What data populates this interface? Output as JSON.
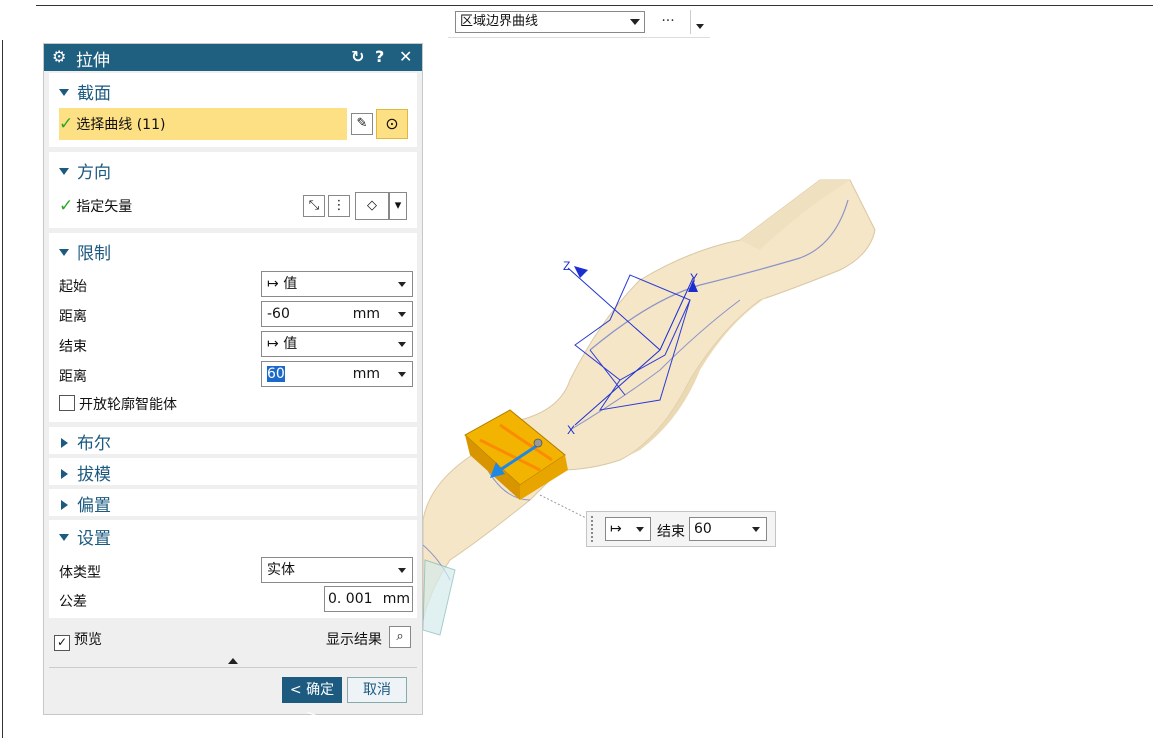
{
  "toolbar": {
    "filter_value": "区域边界曲线",
    "more": "···"
  },
  "dialog": {
    "title": "拉伸",
    "sections": {
      "section": {
        "title": "截面",
        "select_curve": "选择曲线 (11)"
      },
      "direction": {
        "title": "方向",
        "specify_vector": "指定矢量"
      },
      "limits": {
        "title": "限制",
        "start_label": "起始",
        "start_value": "值",
        "start_distance_label": "距离",
        "start_distance_value": "-60",
        "start_distance_unit": "mm",
        "end_label": "结束",
        "end_value": "值",
        "end_distance_label": "距离",
        "end_distance_value": "60",
        "end_distance_unit": "mm",
        "open_profile_label": "开放轮廓智能体"
      },
      "boolean": {
        "title": "布尔"
      },
      "draft": {
        "title": "拔模"
      },
      "offset": {
        "title": "偏置"
      },
      "settings": {
        "title": "设置",
        "body_type_label": "体类型",
        "body_type_value": "实体",
        "tolerance_label": "公差",
        "tolerance_value": "0. 001",
        "tolerance_unit": "mm"
      }
    },
    "preview_label": "预览",
    "show_result_label": "显示结果",
    "ok_label": "< 确定 >",
    "cancel_label": "取消"
  },
  "float_handle": {
    "end_label": "结束",
    "end_value": "60"
  },
  "viewport": {
    "axis_x": "X",
    "axis_y": "Y",
    "axis_z": "Z",
    "accent_yellow": "#f2b400",
    "part_color": "#f5e6c8"
  }
}
